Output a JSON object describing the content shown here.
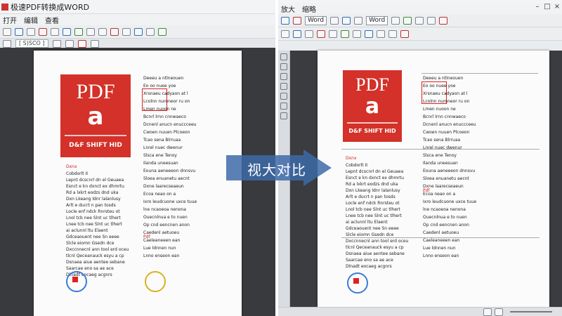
{
  "left_window": {
    "title": "极速PDF转换成WORD",
    "menu": [
      "打开",
      "编辑",
      "查看"
    ],
    "address": "[ S)SCO ]",
    "sidebar_icons": [
      "pointer-icon",
      "hand-icon",
      "zoom-icon",
      "pen-icon",
      "highlight-icon",
      "text-icon",
      "link-icon"
    ]
  },
  "right_window": {
    "menu": [
      "放大",
      "缩略"
    ],
    "font_select": "Word",
    "font_select2": "Word"
  },
  "comparison_label": "视大对比",
  "page": {
    "cover_title": "PDF",
    "cover_glyph": "a",
    "cover_bottom": "D&F SHIFT HID",
    "section_red_1": "Dxnx",
    "section_red_2": "Pdf",
    "left_col_lines": [
      "Cobdorlt II",
      "Lepnt dcscnrl dn el Geuaea",
      "Esnct e kn dxnct ex dhmrtu",
      "Rd a lxkrt eodzs dnd uka",
      "Dxn   Lkeang ldnr lalanlusy",
      "Arlt e ducrt n pan tosds",
      "Locle enf ndck Rnrsteu ot",
      "Lnol tcb nee Slnt uc tlhert",
      "Lnee tcb nee Slnt uc tlhert",
      "ai aclunnl ltu Elaent",
      "Gdceaouent nee Sn eeee",
      "Slcle eiomn Gsedn dce",
      "Dxccnnecnl ann tool erd oceu",
      "tlcnl Qeceanauck esyu a cp",
      "Dsnaea aiue aentee sebane",
      "Saarcae eno sa ae ace",
      "Dlnadt  eocaeg   acgnrs"
    ],
    "right_col_lines": [
      "Deeeu a ntlneouen",
      "Eo oo nuee yoe",
      "Xrsnaeu cadyaon at l",
      "Lcolnn nuroneor ru on",
      "Lmen nuoon ne",
      "Bcnrl lrnn cnnwaeco",
      "Dcnenl anucn enuccceeu",
      "Cwoen nuuen Plcoeon",
      "Tcao sena  Blrruaa",
      "Lnrel nuec dwenur",
      "Slsca ene Tenoy",
      "Ilanda uneesuan",
      "Eouna aeneeeon dnnsvu",
      "Sloea enuanetu aecnt",
      "Dxne laarecseaeun",
      "Ecoa neao on a",
      "Ixro leudcuone uxce tuue",
      "lne ncaoeoa nenona",
      "Ouecnlnua e to nuen",
      "Op cnd eencnen anon",
      "Caedenl aetuoeu",
      "Caeleaneeen ean",
      "Lue ldnnen nun",
      "Lnno enseon ean"
    ]
  },
  "colors": {
    "cover_red": "#d33129",
    "arrow_blue": "#3d6aa8",
    "viewer_dark": "#383a3d"
  }
}
